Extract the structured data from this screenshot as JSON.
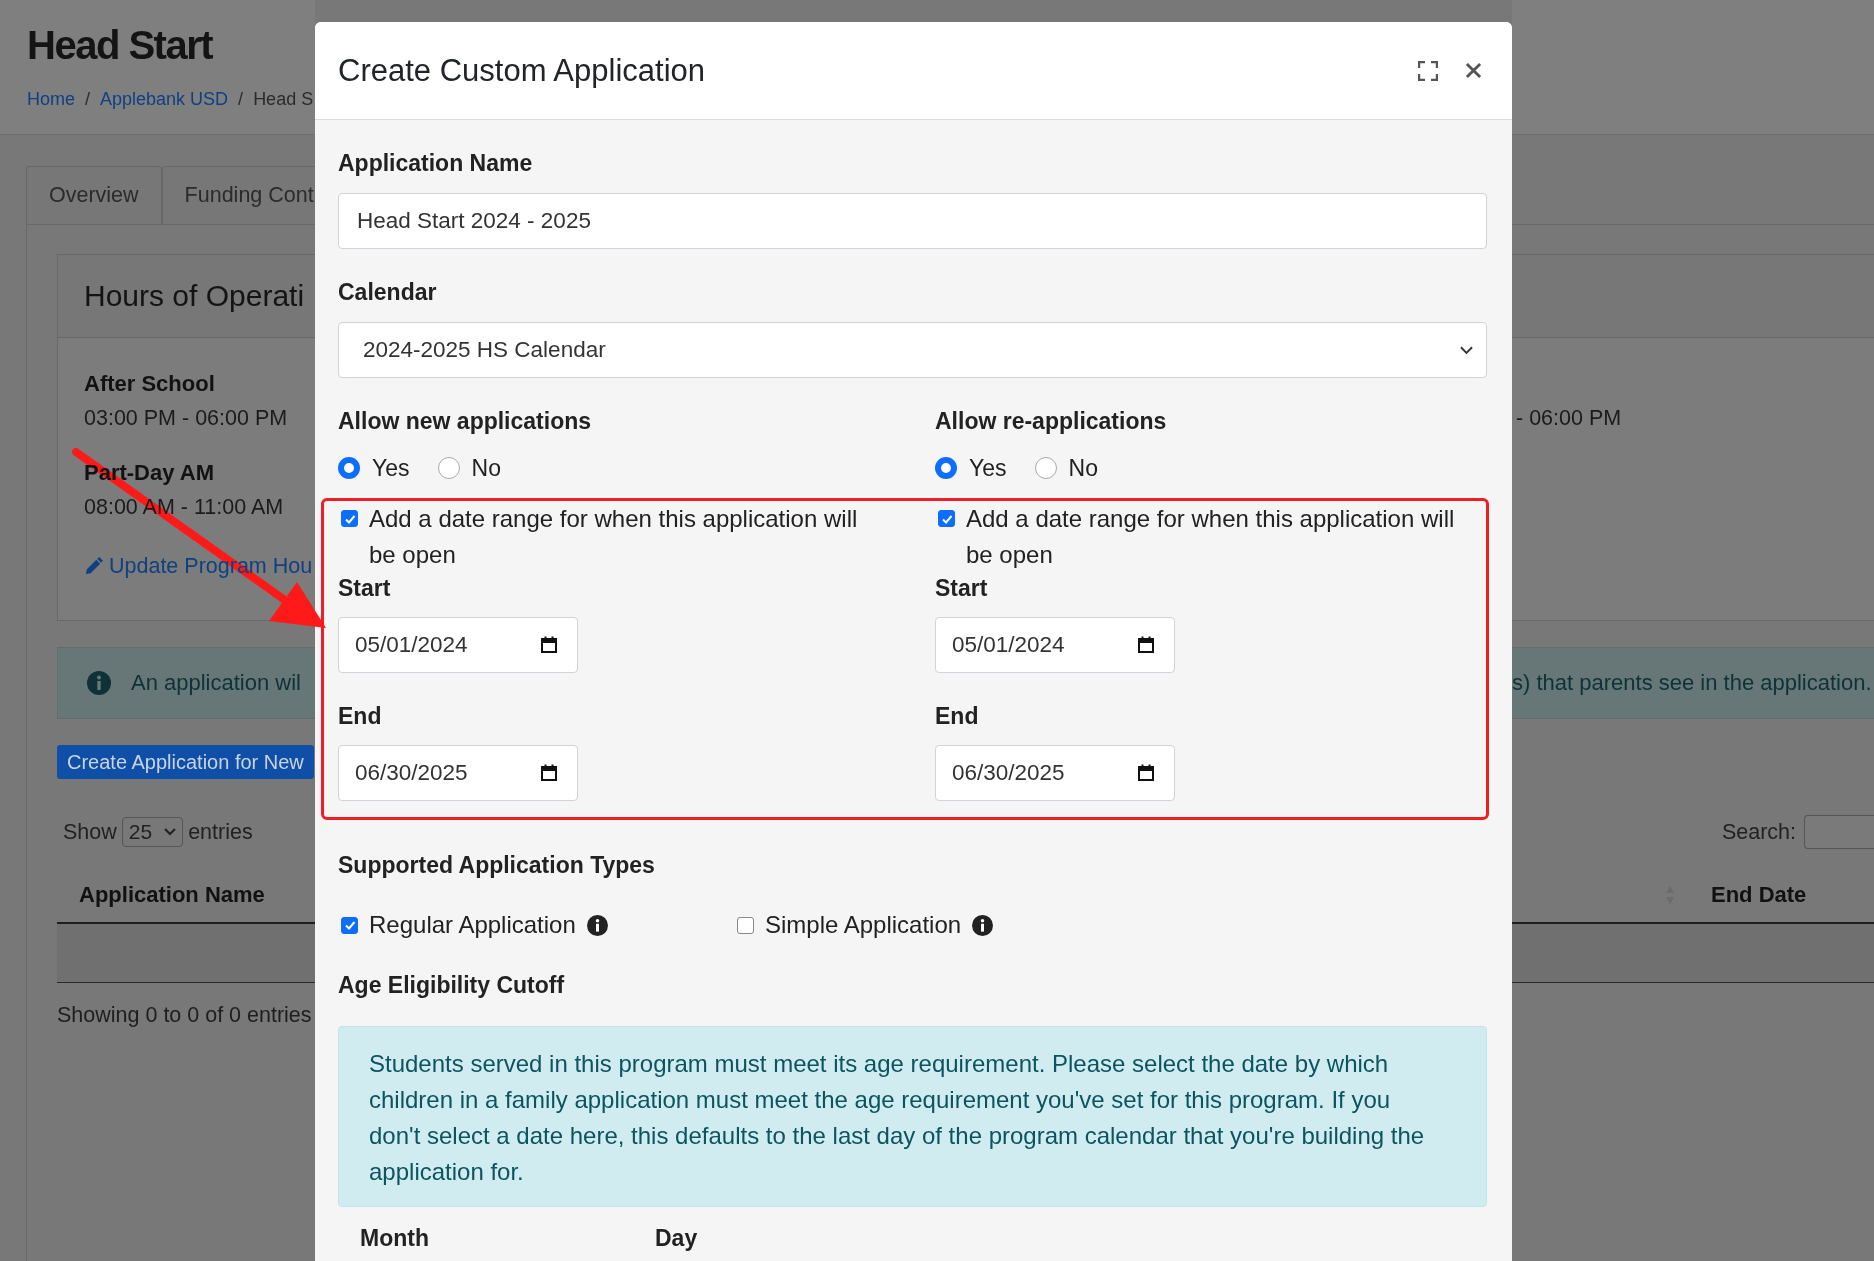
{
  "page": {
    "title": "Head Start",
    "breadcrumb": {
      "separator": "/",
      "items": [
        {
          "label": "Home"
        },
        {
          "label": "Applebank USD"
        },
        {
          "label": "Head S"
        }
      ]
    },
    "tabs": [
      {
        "label": "Overview",
        "selected": false
      },
      {
        "label": "Funding Cont",
        "selected": false
      }
    ],
    "hours_card": {
      "title": "Hours of Operati",
      "entries": [
        {
          "name": "After School",
          "time": "03:00 PM - 06:00 PM"
        },
        {
          "name": "Part-Day AM",
          "time": "08:00 AM - 11:00 AM"
        }
      ],
      "right_times": [
        "- 06:00 PM"
      ],
      "update_link": "Update Program Hou"
    },
    "alert": {
      "left_text": "An application wil",
      "right_text": "s) that parents see in the application."
    },
    "create_button": "Create Application for New",
    "table_controls": {
      "show_label": "Show",
      "page_size": "25",
      "entries_label": "entries",
      "search_label": "Search:"
    },
    "table": {
      "columns": [
        {
          "label": "Application Name"
        },
        {
          "label": "End Date"
        }
      ]
    },
    "table_info": "Showing 0 to 0 of 0 entries"
  },
  "modal": {
    "title": "Create Custom Application",
    "application_name": {
      "label": "Application Name",
      "value": "Head Start 2024 - 2025"
    },
    "calendar": {
      "label": "Calendar",
      "value": "2024-2025 HS Calendar"
    },
    "application_modes": [
      {
        "label": "Allow new applications",
        "options": [
          {
            "label": "Yes",
            "selected": true
          },
          {
            "label": "No",
            "selected": false
          }
        ],
        "date_range": {
          "label": "Add a date range for when this application will be open",
          "checked": true,
          "start_label": "Start",
          "start": "05/01/2024",
          "end_label": "End",
          "end": "06/30/2025"
        }
      },
      {
        "label": "Allow re-applications",
        "options": [
          {
            "label": "Yes",
            "selected": true
          },
          {
            "label": "No",
            "selected": false
          }
        ],
        "date_range": {
          "label": "Add a date range for when this application will be open",
          "checked": true,
          "start_label": "Start",
          "start": "05/01/2024",
          "end_label": "End",
          "end": "06/30/2025"
        }
      }
    ],
    "types": {
      "label": "Supported Application Types",
      "options": [
        {
          "label": "Regular Application",
          "checked": true
        },
        {
          "label": "Simple Application",
          "checked": false
        }
      ]
    },
    "age_cutoff": {
      "label": "Age Eligibility Cutoff",
      "info": "Students served in this program must meet its age requirement. Please select the date by which children in a family application must meet the age requirement you've set for this program. If you don't select a date here, this defaults to the last day of the program calendar that you're building the application for.",
      "columns": [
        "Month",
        "Day"
      ]
    }
  }
}
